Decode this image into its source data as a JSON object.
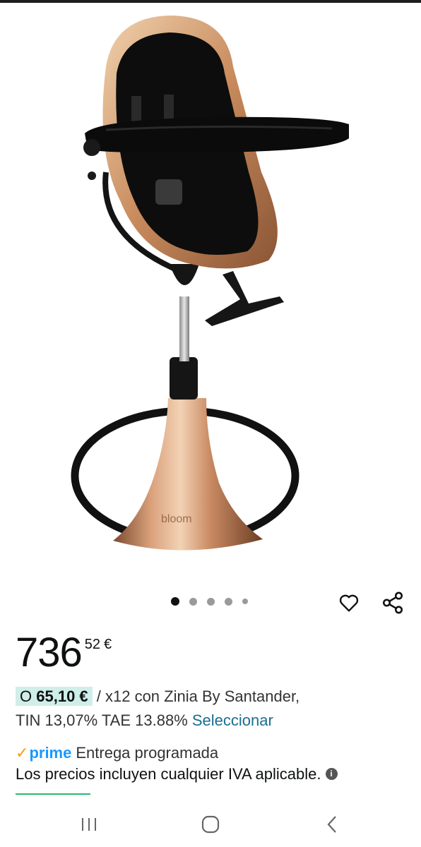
{
  "price": {
    "whole": "736",
    "fraction": "52",
    "currency": "€"
  },
  "financing": {
    "prefix": "O",
    "amount": "65,10 €",
    "rest": " / x12 con Zinia By Santander,",
    "rates": "TIN 13,07% TAE 13.88% ",
    "select_link": "Seleccionar"
  },
  "delivery": {
    "prime_label": "prime",
    "scheduled": "Entrega programada",
    "vat_note": "Los precios incluyen cualquier IVA aplicable."
  },
  "product_image": {
    "brand_text": "bloom"
  },
  "carousel": {
    "count": 5,
    "active_index": 0
  },
  "colors": {
    "accent_link": "#1a6e8e",
    "highlight": "#cfeee9",
    "prime_blue": "#1a98ff",
    "prime_check": "#ff9900"
  },
  "icons": [
    "heart-icon",
    "share-icon",
    "info-icon",
    "recent-apps-icon",
    "home-icon",
    "back-icon"
  ]
}
